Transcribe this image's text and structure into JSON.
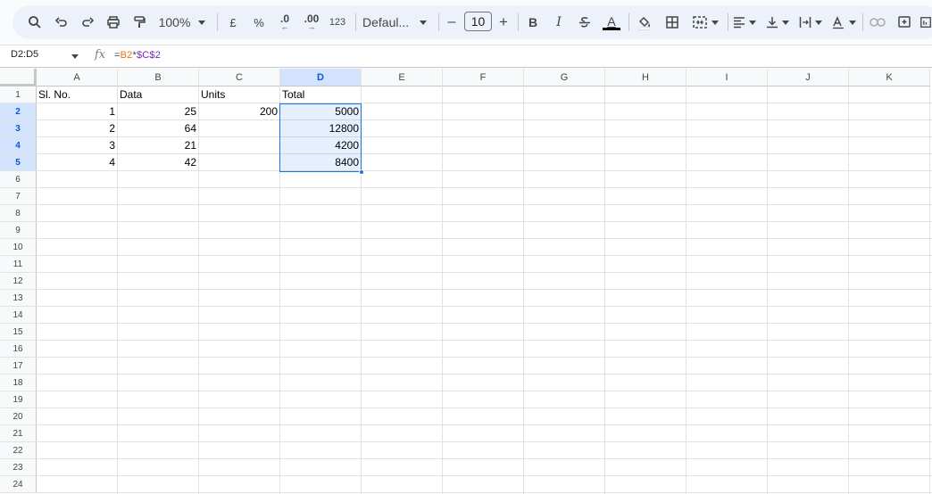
{
  "toolbar": {
    "zoom": "100%",
    "currency": "£",
    "percent": "%",
    "decrease_decimal": ".0",
    "increase_decimal": ".00",
    "number_format": "123",
    "font": "Defaul...",
    "font_size": "10",
    "bold": "B",
    "italic": "I",
    "text_color_letter": "A"
  },
  "formula_bar": {
    "namebox": "D2:D5",
    "fx": "fx",
    "formula_ref1": "B2",
    "formula_op": "*",
    "formula_ref2": "$C$2",
    "formula_prefix": "="
  },
  "columns": [
    "A",
    "B",
    "C",
    "D",
    "E",
    "F",
    "G",
    "H",
    "I",
    "J",
    "K"
  ],
  "rows": [
    "1",
    "2",
    "3",
    "4",
    "5",
    "6",
    "7",
    "8",
    "9",
    "10",
    "11",
    "12",
    "13",
    "14",
    "15",
    "16",
    "17",
    "18",
    "19",
    "20",
    "21",
    "22",
    "23",
    "24"
  ],
  "cells": {
    "A1": "Sl. No.",
    "B1": "Data",
    "C1": "Units",
    "D1": "Total",
    "A2": "1",
    "B2": "25",
    "C2": "200",
    "D2": "5000",
    "A3": "2",
    "B3": "64",
    "D3": "12800",
    "A4": "3",
    "B4": "21",
    "D4": "4200",
    "A5": "4",
    "B5": "42",
    "D5": "8400"
  },
  "selection": {
    "range": "D2:D5",
    "color": "#1a73e8"
  }
}
